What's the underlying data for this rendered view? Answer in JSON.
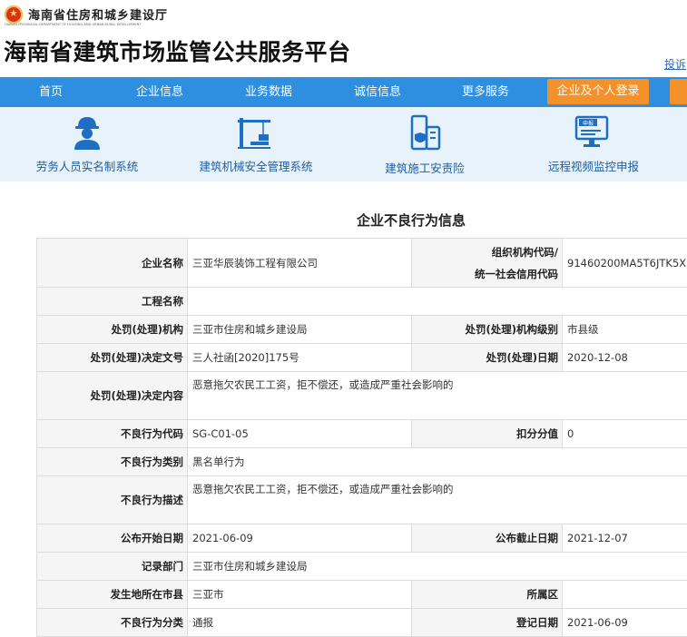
{
  "header": {
    "dept_name": "海南省住房和城乡建设厅",
    "dept_en": "HAINAN PROVINCIAL DEPARTMENT OF HOUSING AND URBAN-RURAL DEVELOPMENT",
    "site_title": "海南省建筑市场监管公共服务平台",
    "complaint_link": "投诉"
  },
  "nav": {
    "items": [
      "首页",
      "企业信息",
      "业务数据",
      "诚信信息",
      "更多服务"
    ],
    "login": "企业及个人登录"
  },
  "quick_links": [
    {
      "label": "劳务人员实名制系统",
      "icon": "worker-icon"
    },
    {
      "label": "建筑机械安全管理系统",
      "icon": "tower-crane-icon"
    },
    {
      "label": "建筑施工安责险",
      "icon": "building-shield-icon"
    },
    {
      "label": "远程视频监控申报",
      "icon": "monitor-report-icon"
    }
  ],
  "colors": {
    "nav": "#2e8ee0",
    "login": "#f4912a",
    "quick_bar_bg": "#e8f2fb",
    "quick_text": "#1f5d9e"
  },
  "section_title": "企业不良行为信息",
  "table": {
    "company_label": "企业名称",
    "company_value": "三亚华辰装饰工程有限公司",
    "org_code_label_1": "组织机构代码/",
    "org_code_label_2": "统一社会信用代码",
    "org_code_value": "91460200MA5T6JTK5X",
    "project_label": "工程名称",
    "project_value": "",
    "agency_label": "处罚(处理)机构",
    "agency_value": "三亚市住房和城乡建设局",
    "agency_level_label": "处罚(处理)机构级别",
    "agency_level_value": "市县级",
    "doc_no_label": "处罚(处理)决定文号",
    "doc_no_value": "三人社函[2020]175号",
    "date_label": "处罚(处理)日期",
    "date_value": "2020-12-08",
    "content_label": "处罚(处理)决定内容",
    "content_value": "恶意拖欠农民工工资，拒不偿还，或造成严重社会影响的",
    "code_label": "不良行为代码",
    "code_value": "SG-C01-05",
    "score_label": "扣分分值",
    "score_value": "0",
    "category_label": "不良行为类别",
    "category_value": "黑名单行为",
    "desc_label": "不良行为描述",
    "desc_value": "恶意拖欠农民工工资，拒不偿还，或造成严重社会影响的",
    "pub_start_label": "公布开始日期",
    "pub_start_value": "2021-06-09",
    "pub_end_label": "公布截止日期",
    "pub_end_value": "2021-12-07",
    "record_dept_label": "记录部门",
    "record_dept_value": "三亚市住房和城乡建设局",
    "city_label": "发生地所在市县",
    "city_value": "三亚市",
    "district_label": "所属区",
    "district_value": "",
    "class_label": "不良行为分类",
    "class_value": "通报",
    "reg_date_label": "登记日期",
    "reg_date_value": "2021-06-09"
  }
}
